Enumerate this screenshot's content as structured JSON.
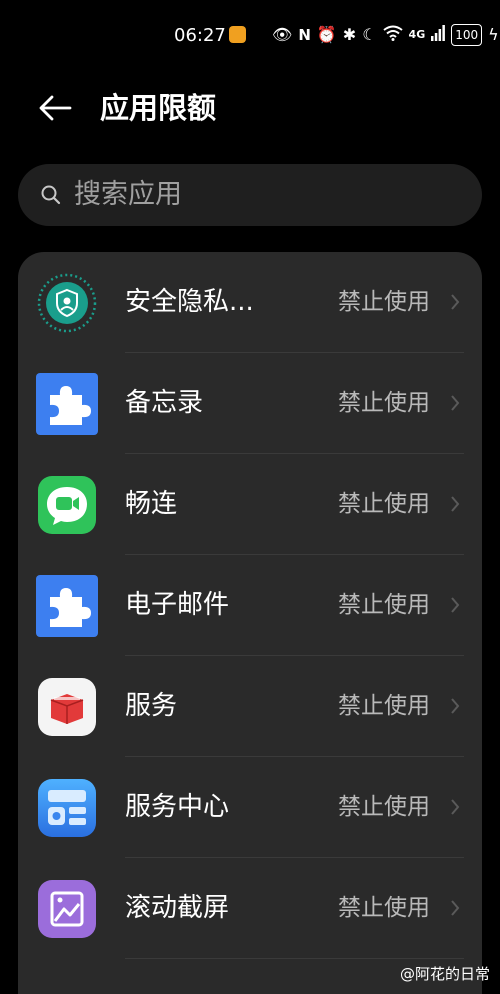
{
  "status_bar": {
    "time": "06:27",
    "network": "4G",
    "battery": "100"
  },
  "header": {
    "title": "应用限额"
  },
  "search": {
    "placeholder": "搜索应用"
  },
  "apps": [
    {
      "name": "安全隐私...",
      "status": "禁止使用",
      "icon": "security-privacy-icon"
    },
    {
      "name": "备忘录",
      "status": "禁止使用",
      "icon": "puzzle-icon"
    },
    {
      "name": "畅连",
      "status": "禁止使用",
      "icon": "video-call-icon"
    },
    {
      "name": "电子邮件",
      "status": "禁止使用",
      "icon": "puzzle-icon"
    },
    {
      "name": "服务",
      "status": "禁止使用",
      "icon": "service-box-icon"
    },
    {
      "name": "服务中心",
      "status": "禁止使用",
      "icon": "service-center-icon"
    },
    {
      "name": "滚动截屏",
      "status": "禁止使用",
      "icon": "scroll-screenshot-icon"
    }
  ],
  "colors": {
    "background": "#000000",
    "card": "#2a2a2a",
    "puzzle_blue": "#3d7ff0",
    "green": "#2fc35a",
    "teal": "#1a9e8c",
    "purple": "#9b6ddb"
  },
  "watermark": "@阿花的日常"
}
